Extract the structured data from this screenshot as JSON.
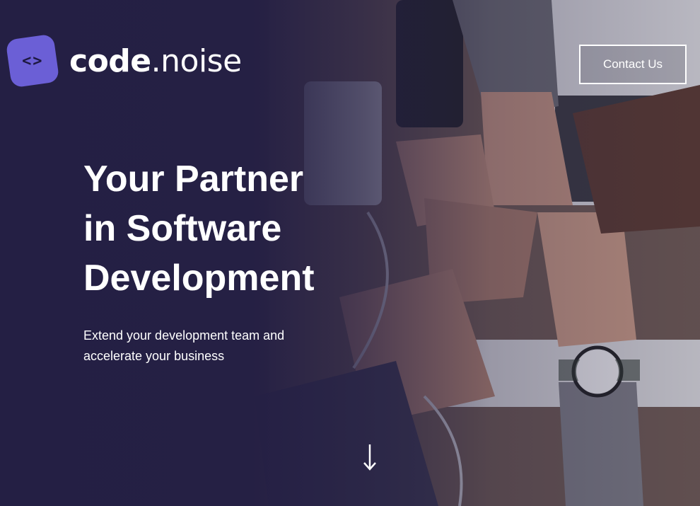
{
  "brand": {
    "mark_glyph": "<>",
    "name_bold": "code",
    "name_light": ".noise",
    "accent_color": "#6b5fd6"
  },
  "nav": {
    "contact_label": "Contact Us"
  },
  "hero": {
    "headline_lines": [
      "Your Partner",
      "in Software",
      "Development"
    ],
    "subtext_lines": [
      "Extend your development team and",
      "accelerate your business"
    ],
    "background_color": "#241f44",
    "scroll_icon": "arrow-down-icon"
  }
}
